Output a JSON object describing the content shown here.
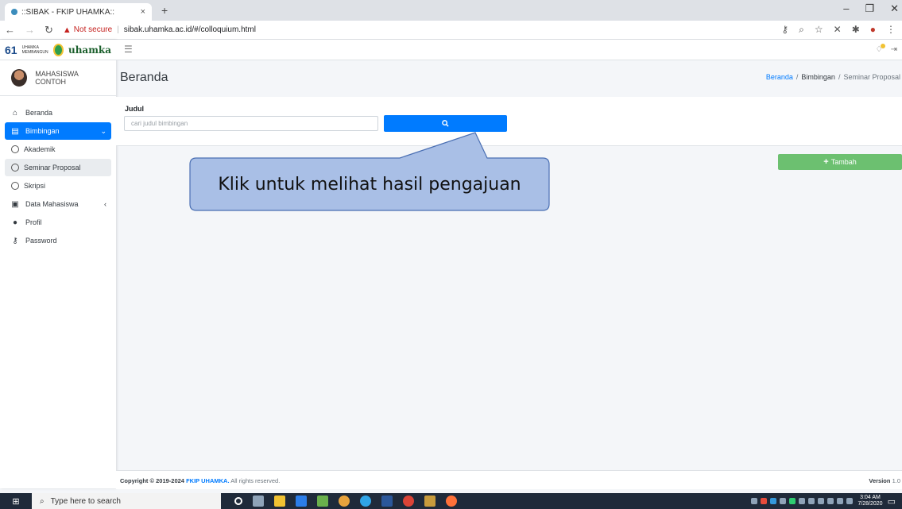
{
  "browser": {
    "tab_title": "::SIBAK - FKIP UHAMKA::",
    "tab_close": "×",
    "new_tab": "+",
    "not_secure": "Not secure",
    "separator": "|",
    "url": "sibak.uhamka.ac.id/#/colloquium.html"
  },
  "sidebar": {
    "logo_number": "61",
    "logo_caption": "UHAMKA MEMBANGUN",
    "logo_word": "uhamka",
    "username": "MAHASISWA CONTOH",
    "items": [
      {
        "label": "Beranda",
        "icon": "home-icon"
      },
      {
        "label": "Bimbingan",
        "icon": "book-icon",
        "active": true
      },
      {
        "label": "Akademik",
        "icon": "circle-icon"
      },
      {
        "label": "Seminar Proposal",
        "icon": "circle-icon",
        "selected": true
      },
      {
        "label": "Skripsi",
        "icon": "circle-icon"
      },
      {
        "label": "Data Mahasiswa",
        "icon": "id-card-icon"
      },
      {
        "label": "Profil",
        "icon": "user-icon"
      },
      {
        "label": "Password",
        "icon": "key-icon"
      }
    ]
  },
  "header": {
    "title": "Beranda",
    "breadcrumb": [
      "Beranda",
      "Bimbingan",
      "Seminar Proposal"
    ],
    "breadcrumb_sep": "/"
  },
  "search": {
    "label": "Judul",
    "placeholder": "cari judul bimbingan"
  },
  "actions": {
    "add_label": "Tambah"
  },
  "callout": {
    "text": "Klik untuk melihat hasil pengajuan"
  },
  "footer": {
    "copyright_prefix": "Copyright © 2019-2024",
    "brand": "FKIP UHAMKA.",
    "rights": "All rights reserved.",
    "version_label": "Version",
    "version_value": "1.0"
  },
  "taskbar": {
    "search_placeholder": "Type here to search",
    "time": "3:04 AM",
    "date": "7/28/2020"
  },
  "colors": {
    "primary": "#007bff",
    "success": "#6cc070",
    "callout_fill": "#a9bfe6",
    "callout_border": "#4a6fb3"
  }
}
